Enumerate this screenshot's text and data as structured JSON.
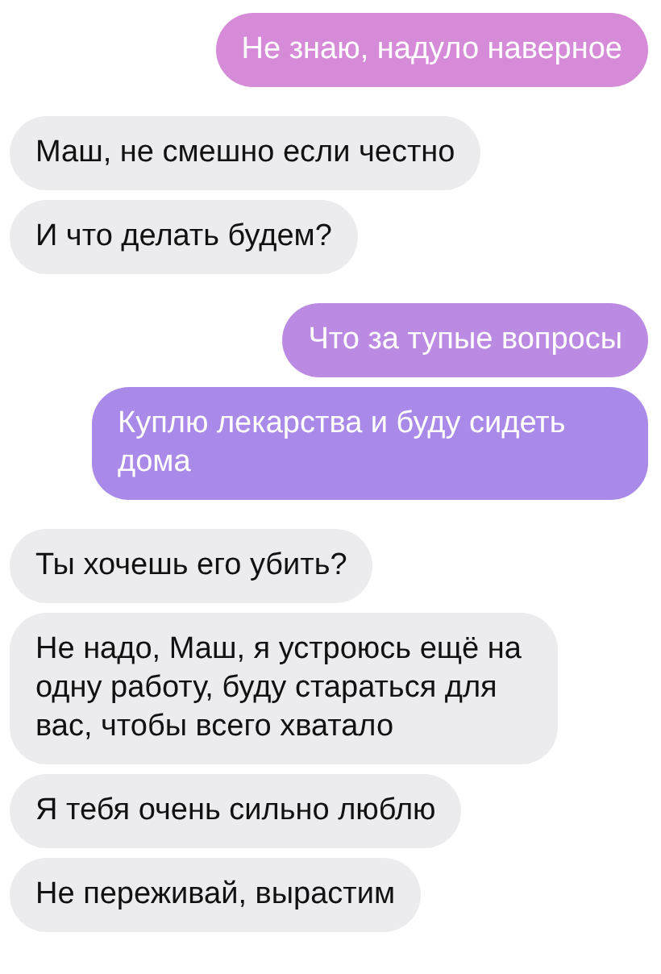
{
  "messages": [
    {
      "kind": "outgoing",
      "text": "Не знаю, надуло наверное",
      "color": "#d68bd8"
    },
    {
      "kind": "incoming",
      "text": "Маш, не смешно если честно"
    },
    {
      "kind": "incoming",
      "text": "И что делать будем?"
    },
    {
      "kind": "outgoing",
      "text": "Что за тупые вопросы",
      "color": "#bb8be4"
    },
    {
      "kind": "outgoing",
      "text": "Куплю лекарства и буду сидеть дома",
      "color": "#a98ae9"
    },
    {
      "kind": "incoming",
      "text": "Ты хочешь его убить?"
    },
    {
      "kind": "incoming",
      "text": "Не надо, Маш, я устроюсь ещё на одну работу, буду стараться для вас, чтобы всего хватало"
    },
    {
      "kind": "incoming",
      "text": "Я тебя очень сильно люблю"
    },
    {
      "kind": "incoming",
      "text": "Не переживай, вырастим"
    }
  ]
}
